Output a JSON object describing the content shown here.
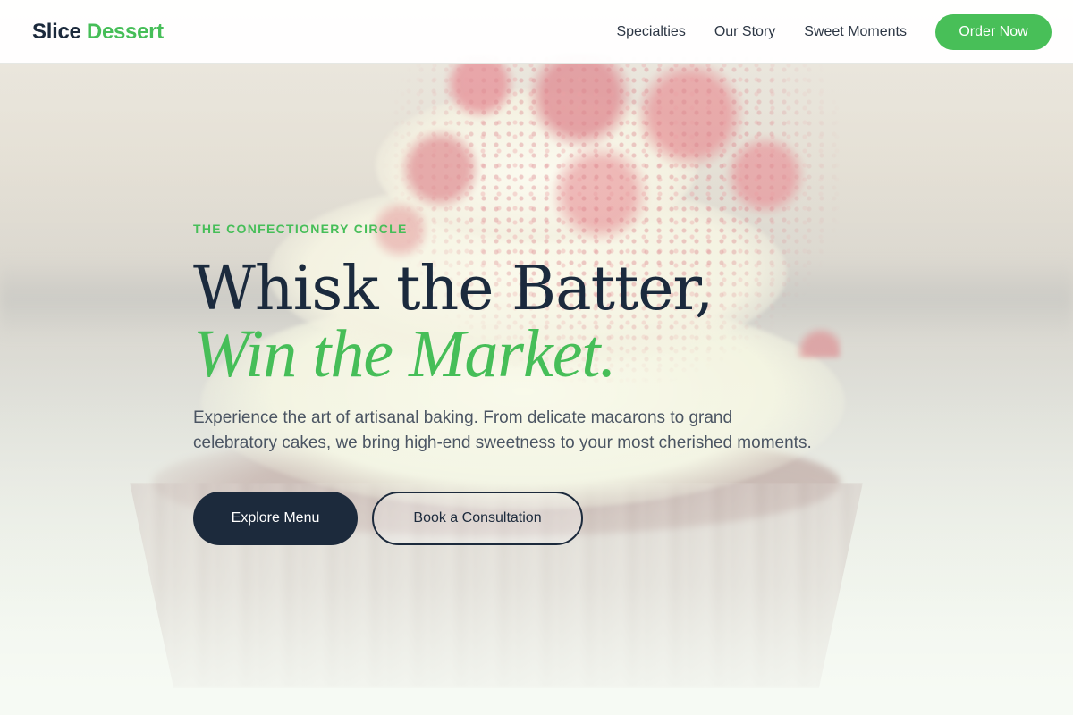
{
  "brand": {
    "part1": "Slice",
    "part2": "Dessert"
  },
  "nav": {
    "links": [
      "Specialties",
      "Our Story",
      "Sweet Moments"
    ],
    "cta_label": "Order Now"
  },
  "hero": {
    "eyebrow": "THE CONFECTIONERY CIRCLE",
    "headline_line1": "Whisk the Batter,",
    "headline_line2": "Win the Market.",
    "description": "Experience the art of artisanal baking. From delicate macarons to grand celebratory cakes, we bring high-end sweetness to your most cherished moments.",
    "primary_button": "Explore Menu",
    "secondary_button": "Book a Consultation"
  },
  "colors": {
    "accent": "#46be58",
    "navy": "#1c2a3c",
    "text_muted": "#4b5563"
  }
}
